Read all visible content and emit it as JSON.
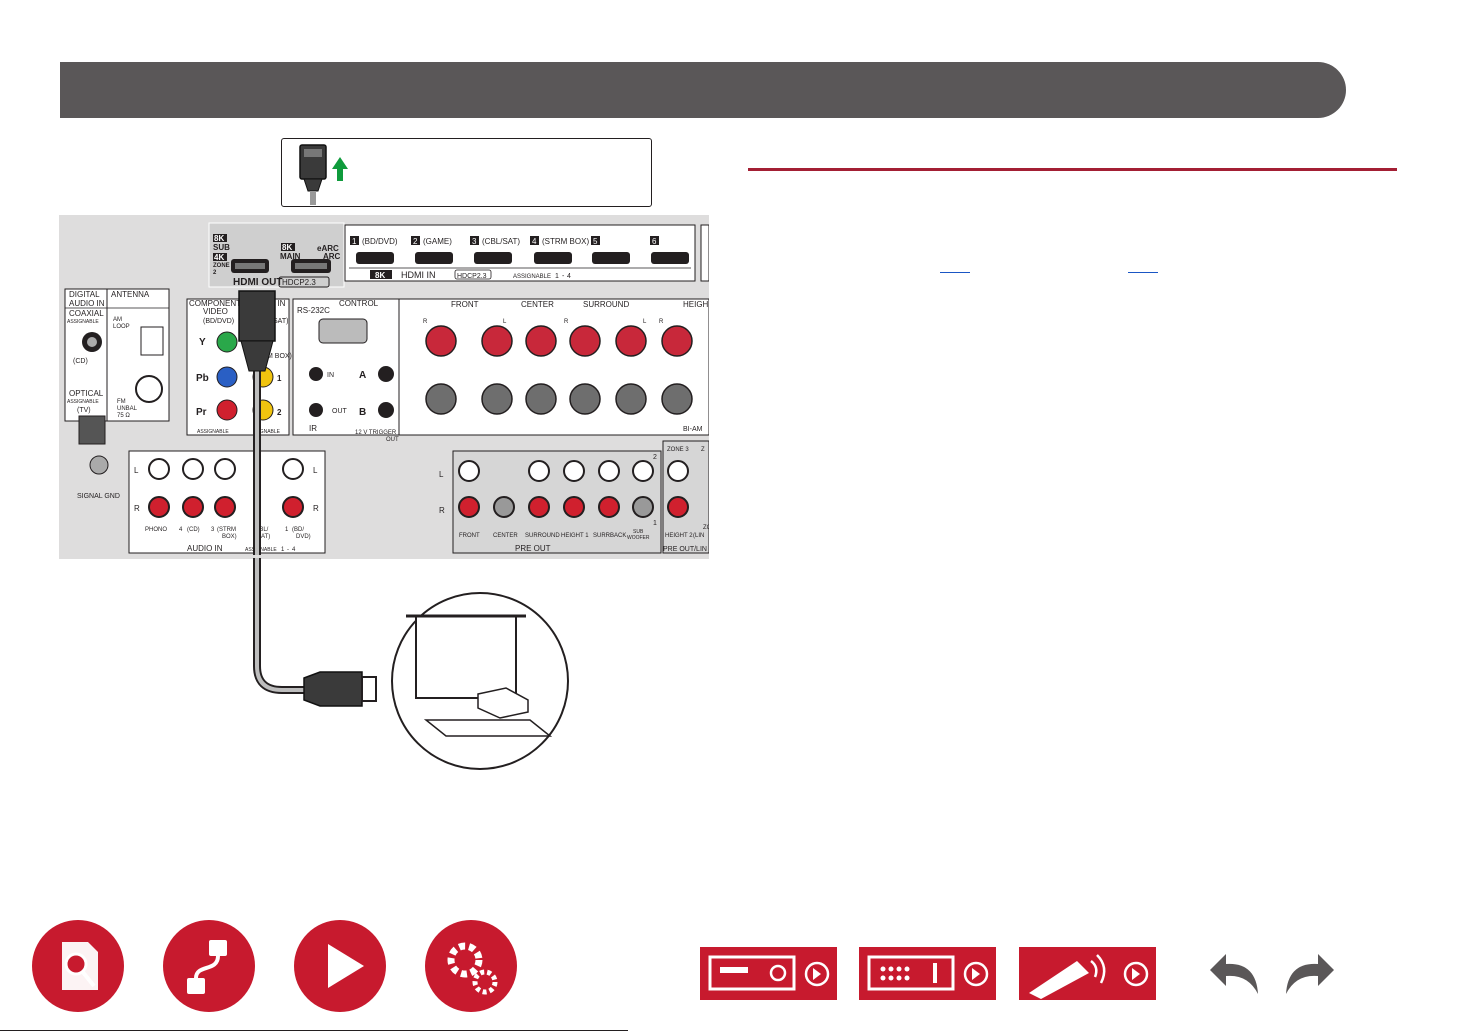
{
  "header": {
    "title": ""
  },
  "diagram": {
    "hdmi_in": {
      "inputs": [
        {
          "num": "1",
          "label": "(BD/DVD)"
        },
        {
          "num": "2",
          "label": "(GAME)"
        },
        {
          "num": "3",
          "label": "(CBL/SAT)"
        },
        {
          "num": "4",
          "label": "(STRM BOX)"
        },
        {
          "num": "5",
          "label": ""
        },
        {
          "num": "6",
          "label": ""
        }
      ],
      "badge": "8K",
      "title": "HDMI IN",
      "hdcp": "HDCP2.3",
      "assignable": "ASSIGNABLE",
      "range_from": "1",
      "range_sep": "-",
      "range_to": "4"
    },
    "hdmi_out": {
      "sub_badge": "8K",
      "sub_label": "SUB",
      "zone_badge": "4K",
      "zone_label": "ZONE",
      "zone_num": "2",
      "main_badge": "8K",
      "main_label": "MAIN",
      "earc": "eARC",
      "arc": "ARC",
      "title": "HDMI OUT",
      "hdcp": "HDCP2.3"
    },
    "digital_audio_in": {
      "title1": "DIGITAL",
      "title2": "AUDIO IN",
      "coaxial": "COAXIAL",
      "coaxial_assign": "ASSIGNABLE",
      "coaxial_src": "(CD)",
      "optical": "OPTICAL",
      "optical_assign": "ASSIGNABLE",
      "optical_src": "(TV)"
    },
    "antenna": {
      "title": "ANTENNA",
      "am1": "AM",
      "am2": "LOOP",
      "fm1": "FM",
      "fm2": "UNBAL",
      "fm3": "75 Ω"
    },
    "component": {
      "title1": "COMPONENT",
      "title2": "VIDEO",
      "src": "(BD/DVD)",
      "y": "Y",
      "pb": "Pb",
      "pr": "Pr",
      "assign": "ASSIGNABLE",
      "video_in": "O IN",
      "v_src1": "SAT)",
      "v_src2": "M BOX)",
      "v1": "1",
      "v2": "2",
      "v_assign": "SIGNABLE"
    },
    "control": {
      "title": "CONTROL",
      "rs232c": "RS-232C",
      "ir_in": "IN",
      "ir_out": "OUT",
      "ir": "IR",
      "trig_a": "A",
      "trig_b": "B",
      "trigger": "12 V  TRIGGER",
      "trigger_out": "OUT"
    },
    "speakers": {
      "front": "FRONT",
      "center": "CENTER",
      "surround": "SURROUND",
      "height": "HEIGH",
      "r": "R",
      "l": "L",
      "biamp": "BI-AM"
    },
    "signal_gnd": "SIGNAL GND",
    "audio_in": {
      "title": "AUDIO IN",
      "l": "L",
      "r": "R",
      "phono": "PHONO",
      "cd_num": "4",
      "cd": "(CD)",
      "strm_num": "3",
      "strm1": "(STRM",
      "strm2": "BOX)",
      "cbl1": "CBL/",
      "cbl2": "SAT)",
      "bd_num": "1",
      "bd1": "(BD/",
      "bd2": "DVD)",
      "assign": "ASSIGNABLE",
      "range_from": "1",
      "range_sep": "-",
      "range_to": "4"
    },
    "pre_out": {
      "title": "PRE OUT",
      "l": "L",
      "r": "R",
      "two": "2",
      "one": "1",
      "front": "FRONT",
      "center": "CENTER",
      "surround": "SURROUND",
      "height1": "HEIGHT 1",
      "surrback": "SURRBACK",
      "sub1": "SUB",
      "sub2": "WOOFER"
    },
    "zone": {
      "zone3": "ZONE 3",
      "zone_z": "Z",
      "height2": "HEIGHT 2",
      "lin": "(LIN",
      "z_partial": "ZO",
      "pre_out_line": "PRE OUT/LIN"
    }
  },
  "colors": {
    "header": "#5a5758",
    "accent": "#a31f34",
    "nav": "#c71a2e",
    "link": "#1a56c4",
    "arrow_green": "#0f9b3c"
  },
  "nav": {
    "icons": [
      "contents-icon",
      "connections-icon",
      "playback-icon",
      "setup-icon"
    ],
    "tiles": [
      "front-panel-icon",
      "rear-panel-icon",
      "remote-icon"
    ],
    "arrows": [
      "back-arrow-icon",
      "forward-arrow-icon"
    ]
  }
}
